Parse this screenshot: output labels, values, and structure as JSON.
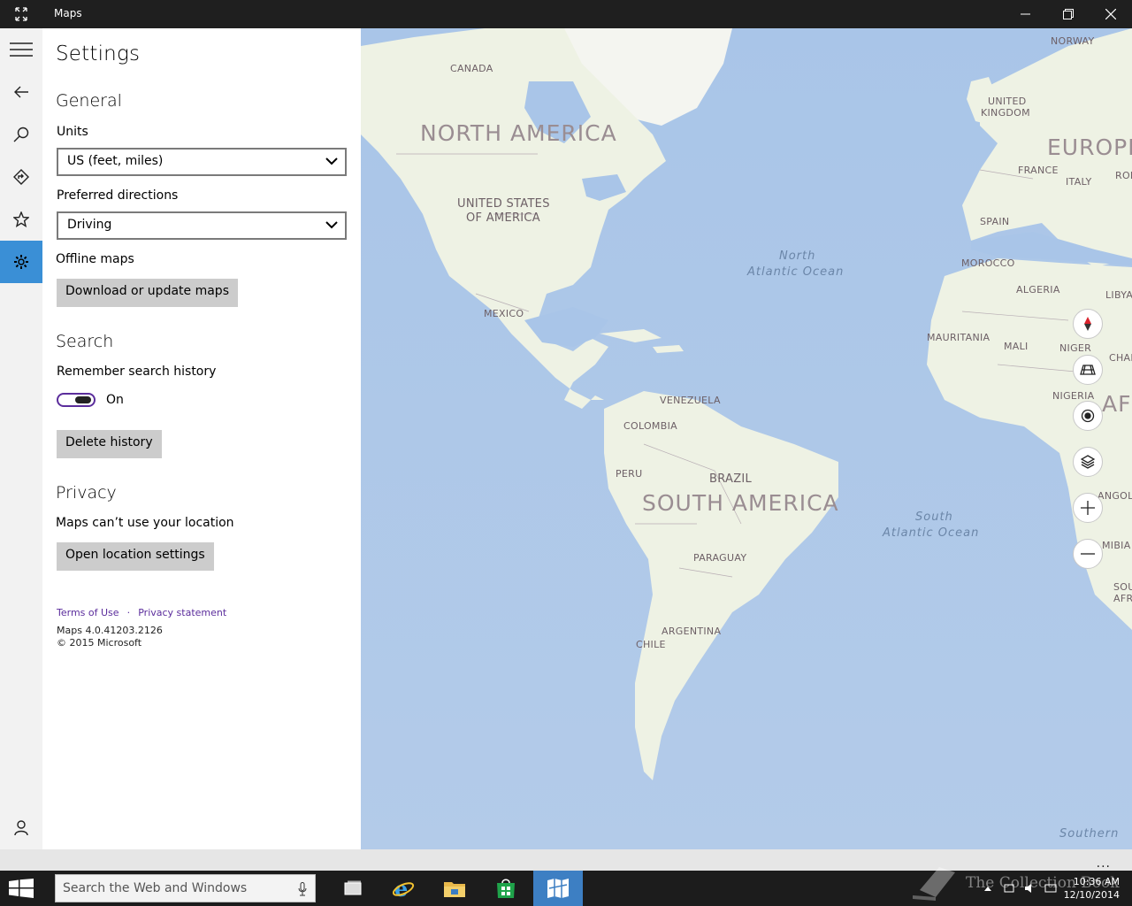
{
  "window": {
    "title": "Maps"
  },
  "settings": {
    "title": "Settings",
    "general": {
      "heading": "General",
      "units_label": "Units",
      "units_value": "US (feet, miles)",
      "directions_label": "Preferred directions",
      "directions_value": "Driving",
      "offline_label": "Offline maps",
      "download_button": "Download or update maps"
    },
    "search": {
      "heading": "Search",
      "history_label": "Remember search history",
      "toggle_state": "On",
      "delete_button": "Delete history"
    },
    "privacy": {
      "heading": "Privacy",
      "location_text": "Maps can’t use your location",
      "location_button": "Open location settings"
    },
    "footer": {
      "terms": "Terms of Use",
      "separator": "·",
      "privacy": "Privacy statement",
      "version": "Maps 4.0.41203.2126",
      "copyright": "© 2015 Microsoft"
    }
  },
  "map": {
    "continents": [
      "NORTH AMERICA",
      "SOUTH AMERICA",
      "EUROPE",
      "AFR"
    ],
    "countries": {
      "canada": "CANADA",
      "usa_1": "UNITED STATES",
      "usa_2": "OF AMERICA",
      "mexico": "MEXICO",
      "venezuela": "VENEZUELA",
      "colombia": "COLOMBIA",
      "peru": "PERU",
      "brazil": "BRAZIL",
      "paraguay": "PARAGUAY",
      "argentina": "ARGENTINA",
      "chile": "CHILE",
      "norway": "NORWAY",
      "uk_1": "UNITED",
      "uk_2": "KINGDOM",
      "france": "FRANCE",
      "italy": "ITALY",
      "spain": "SPAIN",
      "morocco": "MOROCCO",
      "algeria": "ALGERIA",
      "libya": "LIBYA",
      "mauritania": "MAURITANIA",
      "mali": "MALI",
      "niger": "NIGER",
      "chad": "CHAD",
      "nigeria": "NIGERIA",
      "angola": "ANGOLA",
      "rom": "ROM",
      "mibia": "MIBIA",
      "sou": "SOU",
      "afr2": "AFR"
    },
    "oceans": {
      "north_1": "North",
      "north_2": "Atlantic Ocean",
      "south_1": "South",
      "south_2": "Atlantic Ocean",
      "southern": "Southern"
    },
    "controls": [
      "compass-icon",
      "tilt-icon",
      "locate-icon",
      "layers-icon",
      "zoom-in-icon",
      "zoom-out-icon"
    ]
  },
  "appbar": {
    "more": "..."
  },
  "taskbar": {
    "search_placeholder": "Search the Web and Windows",
    "time": "10:36 AM",
    "date": "12/10/2014",
    "watermark": "The Collection Book"
  },
  "colors": {
    "accent": "#3a8fd6",
    "toggle": "#5b2d9c",
    "ocean": "#a8c4e6",
    "land": "#eef2e6"
  }
}
